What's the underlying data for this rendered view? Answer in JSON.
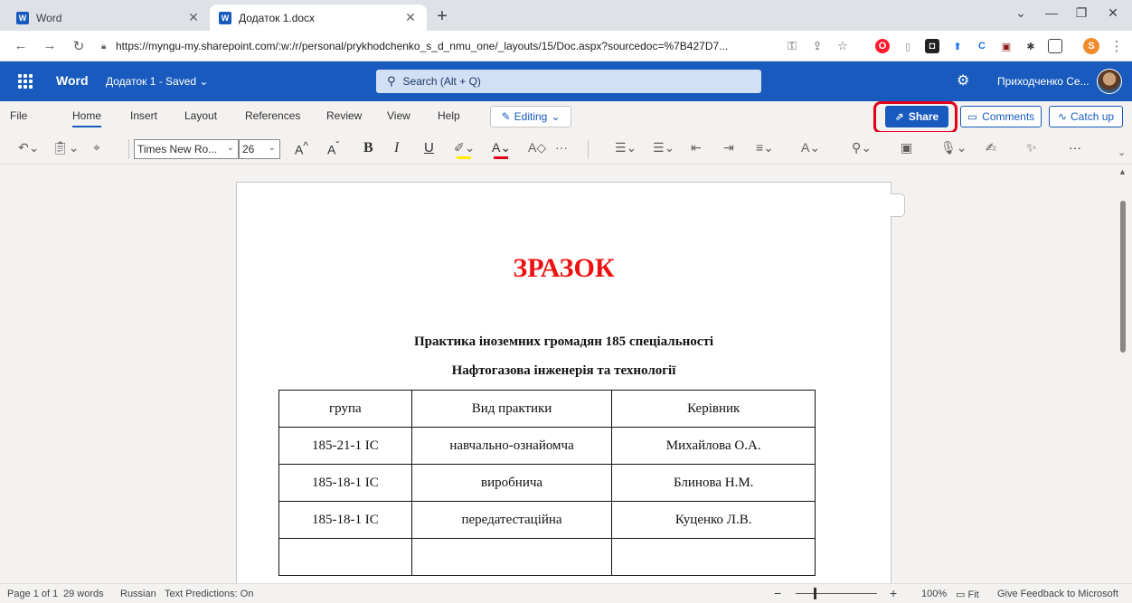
{
  "browser": {
    "tabs": [
      {
        "title": "Word",
        "favicon": "W",
        "active": false
      },
      {
        "title": "Додаток 1.docx",
        "favicon": "W",
        "active": true
      }
    ],
    "url": "https://myngu-my.sharepoint.com/:w:/r/personal/prykhodchenko_s_d_nmu_one/_layouts/15/Doc.aspx?sourcedoc=%7B427D7..."
  },
  "appbar": {
    "app_name": "Word",
    "doc_name": "Додаток 1 - Saved",
    "search_placeholder": "Search (Alt + Q)",
    "user_name": "Приходченко Се..."
  },
  "ribbon": {
    "tabs": [
      "File",
      "Home",
      "Insert",
      "Layout",
      "References",
      "Review",
      "View",
      "Help"
    ],
    "active_tab": "Home",
    "editing_label": "Editing",
    "share_label": "Share",
    "comments_label": "Comments",
    "catchup_label": "Catch up"
  },
  "toolbar": {
    "font_name": "Times New Ro...",
    "font_size": "26",
    "bold": "B",
    "italic": "I",
    "underline": "U",
    "grow": "A",
    "shrink": "A",
    "more": "···"
  },
  "document": {
    "title": "ЗРАЗОК",
    "subtitle_1": "Практика іноземних громадян 185 спеціальності",
    "subtitle_2": "Нафтогазова інженерія та технології",
    "table": {
      "headers": [
        "група",
        "Вид практики",
        "Керівник"
      ],
      "rows": [
        [
          "185-21-1 ІС",
          "навчально-ознайомча",
          "Михайлова О.А."
        ],
        [
          "185-18-1 ІС",
          "виробнича",
          "Блинова Н.М."
        ],
        [
          "185-18-1 ІС",
          "передатестаційна",
          "Куценко Л.В."
        ],
        [
          "",
          "",
          ""
        ]
      ]
    }
  },
  "status": {
    "page": "Page 1 of 1",
    "words": "29 words",
    "language": "Russian",
    "predictions": "Text Predictions: On",
    "zoom": "100%",
    "fit": "Fit",
    "feedback": "Give Feedback to Microsoft"
  },
  "colors": {
    "brand": "#185abd",
    "title_red": "#ee1111",
    "highlight_red": "#e3001b"
  }
}
